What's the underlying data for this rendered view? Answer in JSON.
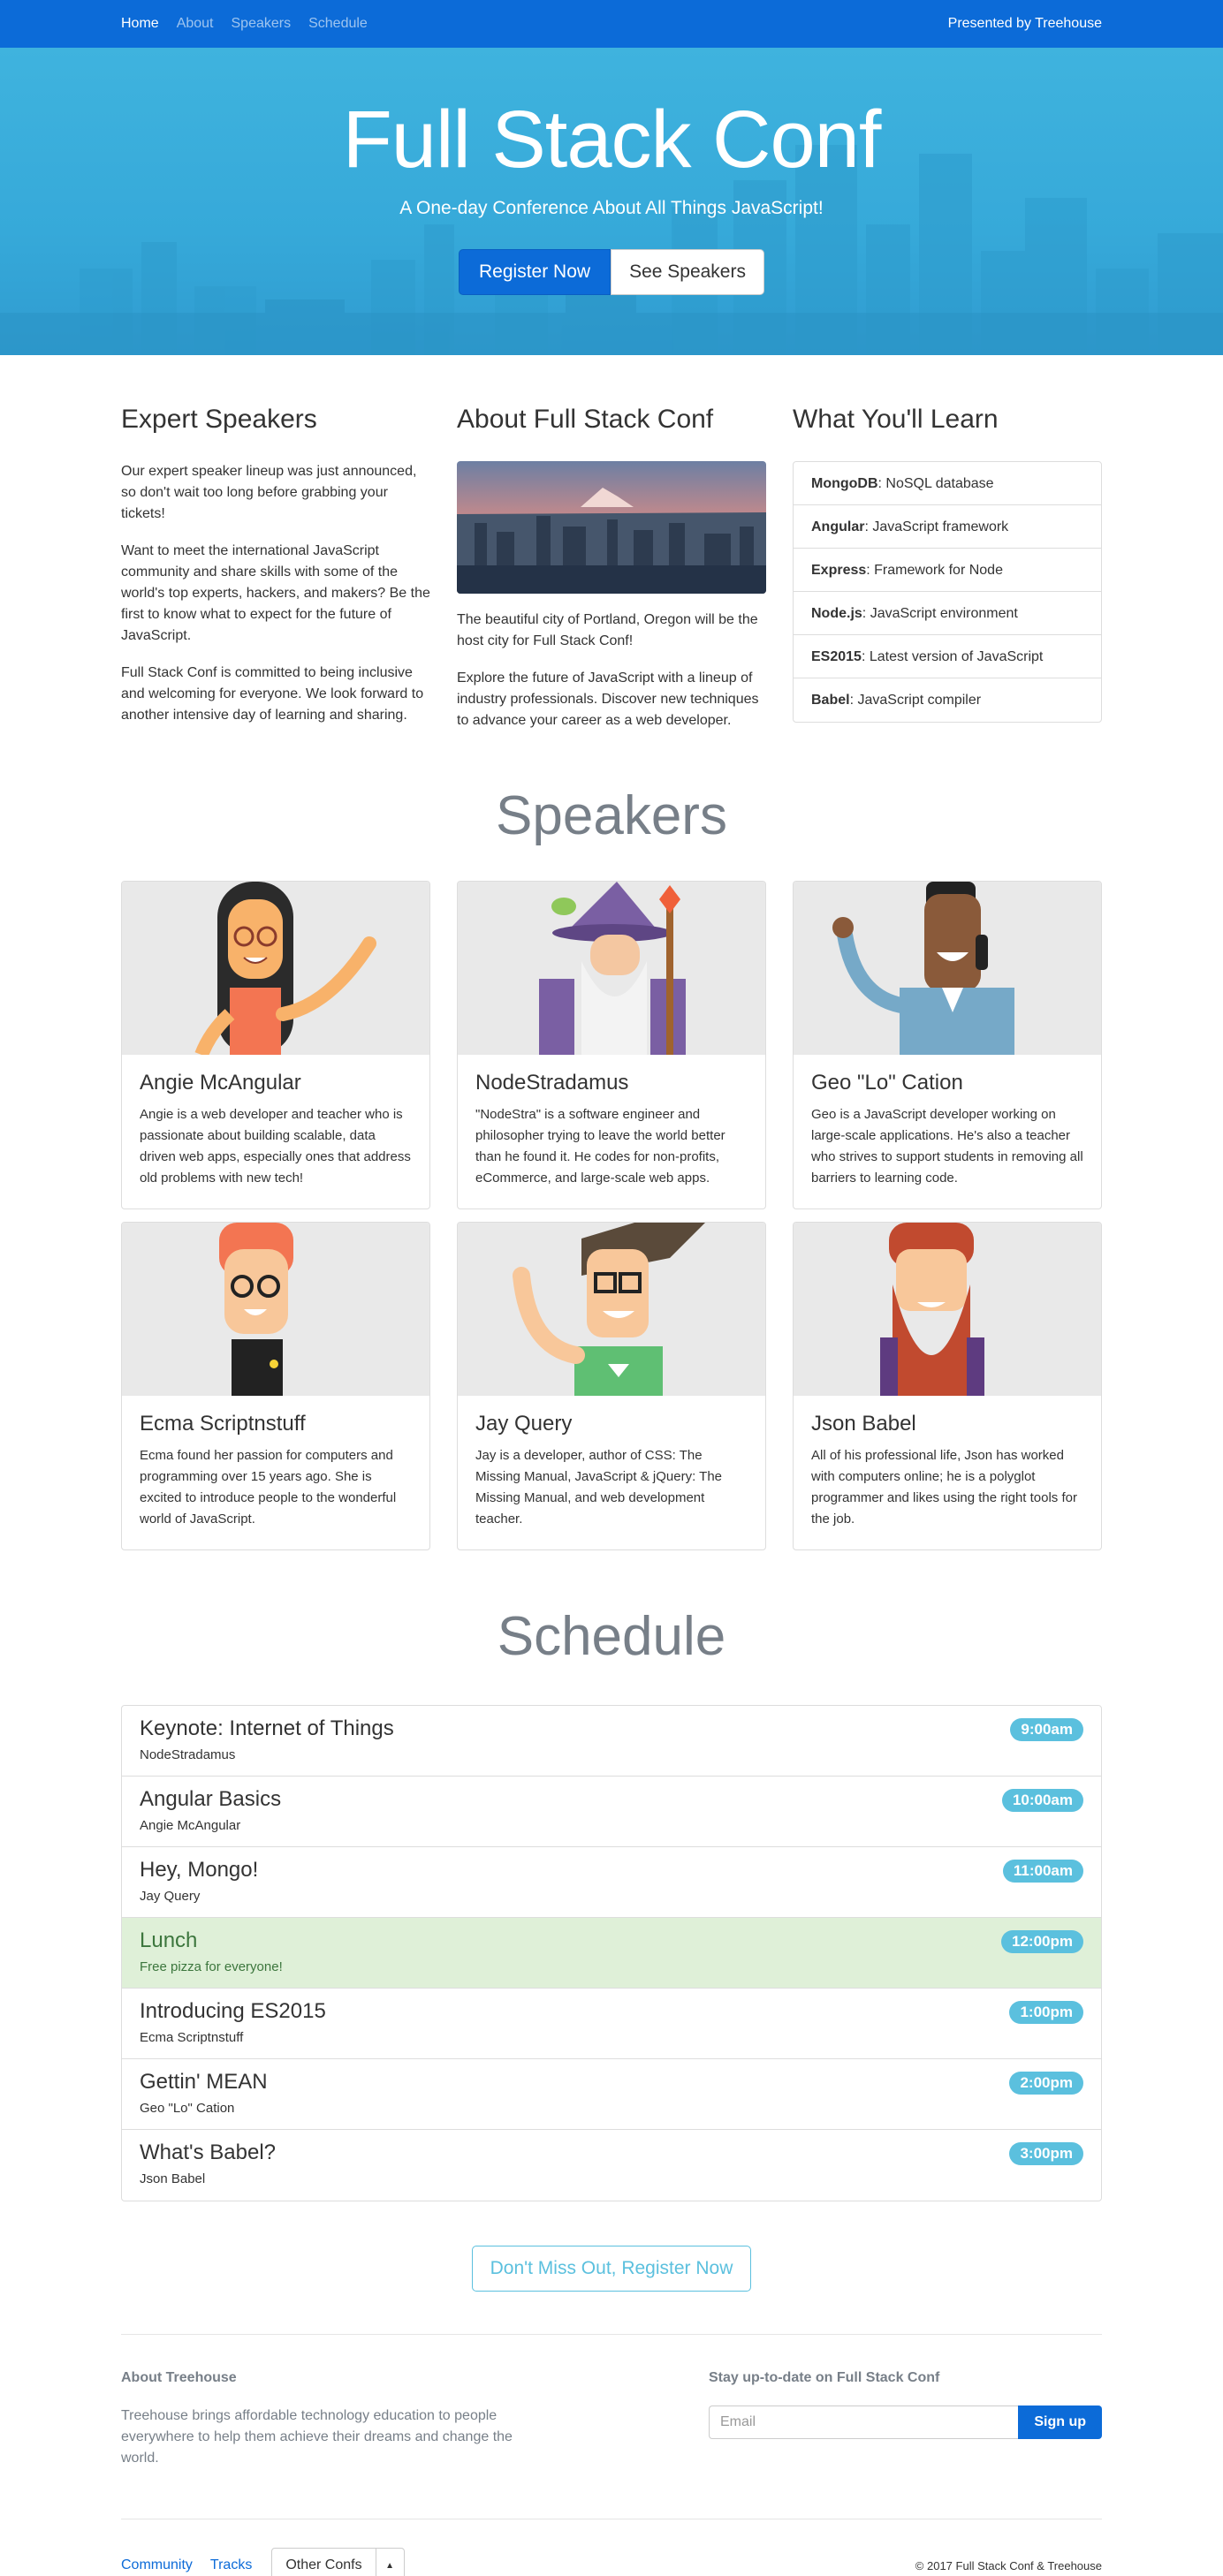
{
  "nav": {
    "links": [
      "Home",
      "About",
      "Speakers",
      "Schedule"
    ],
    "brand": "Presented by Treehouse"
  },
  "hero": {
    "title": "Full Stack Conf",
    "subtitle": "A One-day Conference About All Things JavaScript!",
    "register_label": "Register Now",
    "speakers_label": "See Speakers"
  },
  "intro": {
    "speakers": {
      "heading": "Expert Speakers",
      "paragraphs": [
        "Our expert speaker lineup was just announced, so don't wait too long before grabbing your tickets!",
        "Want to meet the international JavaScript community and share skills with some of the world's top experts, hackers, and makers? Be the first to know what to expect for the future of JavaScript.",
        "Full Stack Conf is committed to being inclusive and welcoming for everyone. We look forward to another intensive day of learning and sharing."
      ]
    },
    "about": {
      "heading": "About Full Stack Conf",
      "paragraphs": [
        "The beautiful city of Portland, Oregon will be the host city for Full Stack Conf!",
        "Explore the future of JavaScript with a lineup of industry professionals. Discover new techniques to advance your career as a web developer."
      ]
    },
    "learn": {
      "heading": "What You'll Learn",
      "items": [
        {
          "name": "MongoDB",
          "desc": ": NoSQL database"
        },
        {
          "name": "Angular",
          "desc": ": JavaScript framework"
        },
        {
          "name": "Express",
          "desc": ": Framework for Node"
        },
        {
          "name": "Node.js",
          "desc": ": JavaScript environment"
        },
        {
          "name": "ES2015",
          "desc": ": Latest version of JavaScript"
        },
        {
          "name": "Babel",
          "desc": ": JavaScript compiler"
        }
      ]
    }
  },
  "speakers_section": {
    "title": "Speakers",
    "cards": [
      {
        "name": "Angie McAngular",
        "bio": "Angie is a web developer and teacher who is passionate about building scalable, data driven web apps, especially ones that address old problems with new tech!"
      },
      {
        "name": "NodeStradamus",
        "bio": "\"NodeStra\" is a software engineer and philosopher trying to leave the world better than he found it. He codes for non-profits, eCommerce, and large-scale web apps."
      },
      {
        "name": "Geo \"Lo\" Cation",
        "bio": "Geo is a JavaScript developer working on large-scale applications. He's also a teacher who strives to support students in removing all barriers to learning code."
      },
      {
        "name": "Ecma Scriptnstuff",
        "bio": "Ecma found her passion for computers and programming over 15 years ago. She is excited to introduce people to the wonderful world of JavaScript."
      },
      {
        "name": "Jay Query",
        "bio": "Jay is a developer, author of CSS: The Missing Manual, JavaScript & jQuery: The Missing Manual, and web development teacher."
      },
      {
        "name": "Json Babel",
        "bio": "All of his professional life, Json has worked with computers online; he is a polyglot programmer and likes using the right tools for the job."
      }
    ]
  },
  "schedule_section": {
    "title": "Schedule",
    "items": [
      {
        "title": "Keynote: Internet of Things",
        "speaker": "NodeStradamus",
        "time": "9:00am"
      },
      {
        "title": "Angular Basics",
        "speaker": "Angie McAngular",
        "time": "10:00am"
      },
      {
        "title": "Hey, Mongo!",
        "speaker": "Jay Query",
        "time": "11:00am"
      },
      {
        "title": "Lunch",
        "speaker": "Free pizza for everyone!",
        "time": "12:00pm"
      },
      {
        "title": "Introducing ES2015",
        "speaker": "Ecma Scriptnstuff",
        "time": "1:00pm"
      },
      {
        "title": "Gettin' MEAN",
        "speaker": "Geo \"Lo\" Cation",
        "time": "2:00pm"
      },
      {
        "title": "What's Babel?",
        "speaker": "Json Babel",
        "time": "3:00pm"
      }
    ]
  },
  "cta": {
    "label": "Don't Miss Out, Register Now"
  },
  "footer": {
    "about_heading": "About Treehouse",
    "about_text": "Treehouse brings affordable technology education to people everywhere to help them achieve their dreams and change the world.",
    "subscribe_heading": "Stay up-to-date on Full Stack Conf",
    "email_placeholder": "Email",
    "signup_label": "Sign up",
    "links": [
      "Community",
      "Tracks"
    ],
    "dropdown_label": "Other Confs",
    "copyright": "© 2017 Full Stack Conf & Treehouse"
  },
  "colors": {
    "primary": "#0c6bd8",
    "hero_bg": "#36a9d9",
    "info_badge": "#5bc0de",
    "lunch_bg": "#dff0d8"
  }
}
